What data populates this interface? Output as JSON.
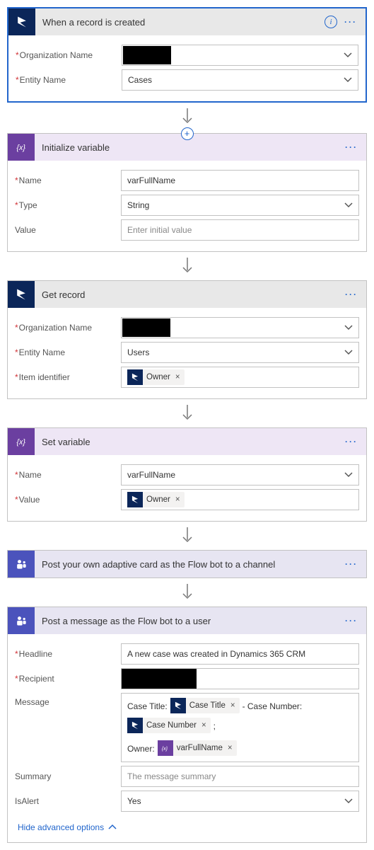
{
  "step1": {
    "title": "When a record is created",
    "fields": {
      "org_label": "Organization Name",
      "entity_label": "Entity Name",
      "entity_value": "Cases"
    }
  },
  "step2": {
    "title": "Initialize variable",
    "fields": {
      "name_label": "Name",
      "name_value": "varFullName",
      "type_label": "Type",
      "type_value": "String",
      "value_label": "Value",
      "value_placeholder": "Enter initial value"
    }
  },
  "step3": {
    "title": "Get record",
    "fields": {
      "org_label": "Organization Name",
      "entity_label": "Entity Name",
      "entity_value": "Users",
      "item_label": "Item identifier",
      "item_token": "Owner"
    }
  },
  "step4": {
    "title": "Set variable",
    "fields": {
      "name_label": "Name",
      "name_value": "varFullName",
      "value_label": "Value",
      "value_token": "Owner"
    }
  },
  "step5": {
    "title": "Post your own adaptive card as the Flow bot to a channel"
  },
  "step6": {
    "title": "Post a message as the Flow bot to a user",
    "fields": {
      "headline_label": "Headline",
      "headline_value": "A new case was created in Dynamics 365 CRM",
      "recipient_label": "Recipient",
      "message_label": "Message",
      "msg_txt_title": "Case Title: ",
      "msg_token_title": "Case Title",
      "msg_txt_number": " - Case Number: ",
      "msg_token_number": "Case Number",
      "msg_txt_semicolon": " ;",
      "msg_txt_owner": "Owner: ",
      "msg_token_owner": "varFullName",
      "summary_label": "Summary",
      "summary_placeholder": "The message summary",
      "isalert_label": "IsAlert",
      "isalert_value": "Yes"
    },
    "hide_advanced": "Hide advanced options"
  }
}
